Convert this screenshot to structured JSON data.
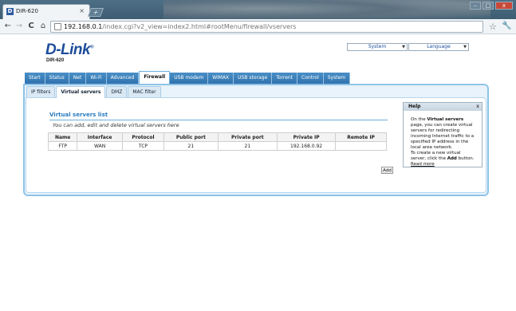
{
  "browser": {
    "tab_title": "DIR-620",
    "tab_favicon": "D",
    "tab_close": "×",
    "new_tab": "+",
    "url_host": "192.168.0.1",
    "url_path": "/index.cgi?v2_view=index2.html#rootMenu/firewall/vservers",
    "back": "←",
    "forward": "→",
    "reload": "C",
    "home": "⌂",
    "star": "☆",
    "wrench": "🔧",
    "win_min": "–",
    "win_max": "□",
    "win_close": "x"
  },
  "header": {
    "logo": "D-Link",
    "logo_mark": "®",
    "model": "DIR-620",
    "system_select": "System",
    "language_select": "Language"
  },
  "main_nav": [
    "Start",
    "Status",
    "Net",
    "Wi-Fi",
    "Advanced",
    "Firewall",
    "USB modem",
    "WiMAX",
    "USB storage",
    "Torrent",
    "Control",
    "System"
  ],
  "main_nav_active": "Firewall",
  "sub_nav": [
    "IP filters",
    "Virtual servers",
    "DMZ",
    "MAC filter"
  ],
  "sub_nav_active": "Virtual servers",
  "section": {
    "title": "Virtual servers list",
    "description": "You can add, edit and delete virtual servers here"
  },
  "table": {
    "headers": [
      "Name",
      "Interface",
      "Protocol",
      "Public port",
      "Private port",
      "Private IP",
      "Remote IP"
    ],
    "rows": [
      [
        "FTP",
        "WAN",
        "TCP",
        "21",
        "21",
        "192.168.0.92",
        ""
      ]
    ]
  },
  "add_button": "Add",
  "help": {
    "title": "Help",
    "close": "x",
    "text_1": "On the ",
    "text_bold_1": "Virtual servers",
    "text_2": " page, you can create virtual servers for redirecting incoming Internet traffic to a specified IP address in the local area network.",
    "text_3": "To create a new virtual server, click the ",
    "text_bold_2": "Add",
    "text_4": " button.",
    "read_more": "Read more"
  },
  "colors": {
    "accent": "#2f72ad",
    "frame": "#8fc3e8",
    "logo": "#1c4c9a"
  }
}
